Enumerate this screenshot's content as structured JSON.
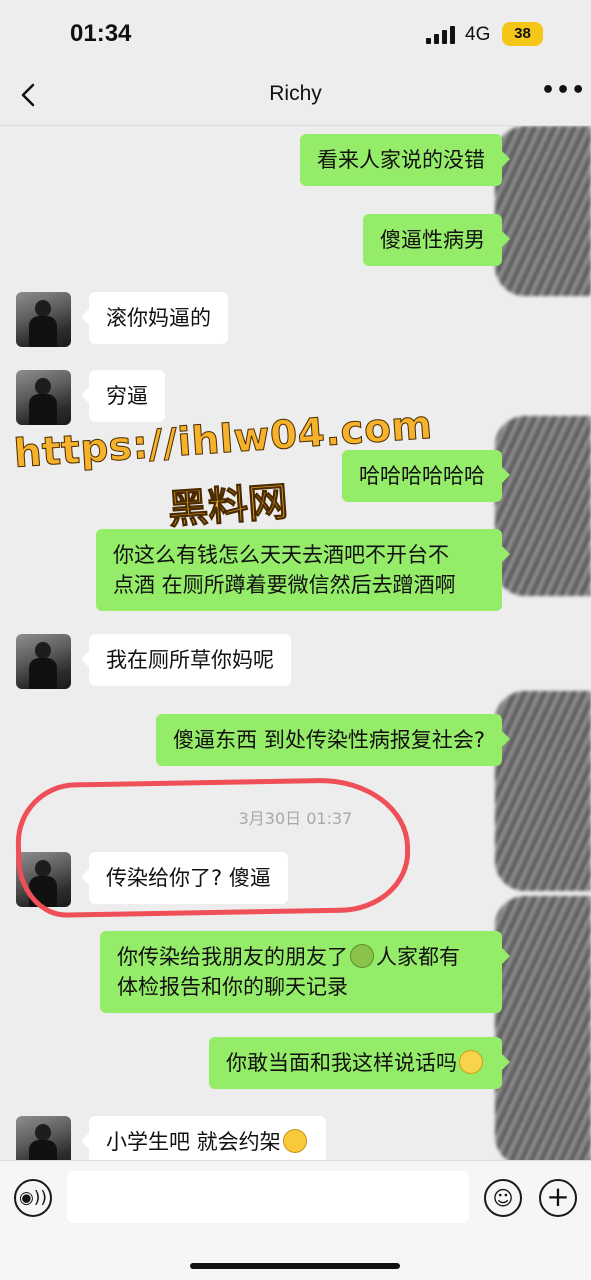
{
  "status_bar": {
    "time": "01:34",
    "network": "4G",
    "battery": "38"
  },
  "nav": {
    "title": "Richy",
    "more": "•••"
  },
  "messages": [
    {
      "from": "me",
      "text": "看来人家说的没错"
    },
    {
      "from": "me",
      "text": "傻逼性病男"
    },
    {
      "from": "Richy",
      "text": "滚你妈逼的"
    },
    {
      "from": "Richy",
      "text": "穷逼"
    },
    {
      "from": "me",
      "text": "哈哈哈哈哈哈"
    },
    {
      "from": "me",
      "text": "你这么有钱怎么天天去酒吧不开台不",
      "text_line2": "点酒  在厕所蹲着要微信然后去蹭酒啊"
    },
    {
      "from": "Richy",
      "text": "我在厕所草你妈呢"
    },
    {
      "from": "me",
      "text": "傻逼东西  到处传染性病报复社会?"
    },
    {
      "from": "Richy",
      "text": "传染给你了? 傻逼"
    },
    {
      "from": "me",
      "text": "你传染给我朋友的朋友了",
      "text_after_emoji": "人家都有",
      "text_line2": "体检报告和你的聊天记录",
      "emoji": "nauseated-face-icon"
    },
    {
      "from": "me",
      "text": "你敢当面和我这样说话吗",
      "emoji": "fearful-face-icon"
    },
    {
      "from": "Richy",
      "text": "小学生吧 就会约架",
      "emoji": "thinking-face-icon"
    }
  ],
  "timestamp": "3月30日 01:37",
  "watermark": {
    "url": "https://ihlw04.com",
    "name": "黑料网"
  },
  "input": {
    "placeholder": ""
  },
  "colors": {
    "sent_bubble": "#95ec69",
    "received_bubble": "#ffffff",
    "background": "#ededed",
    "annotation_circle": "#ef4f57",
    "watermark": "#f5b22a"
  }
}
